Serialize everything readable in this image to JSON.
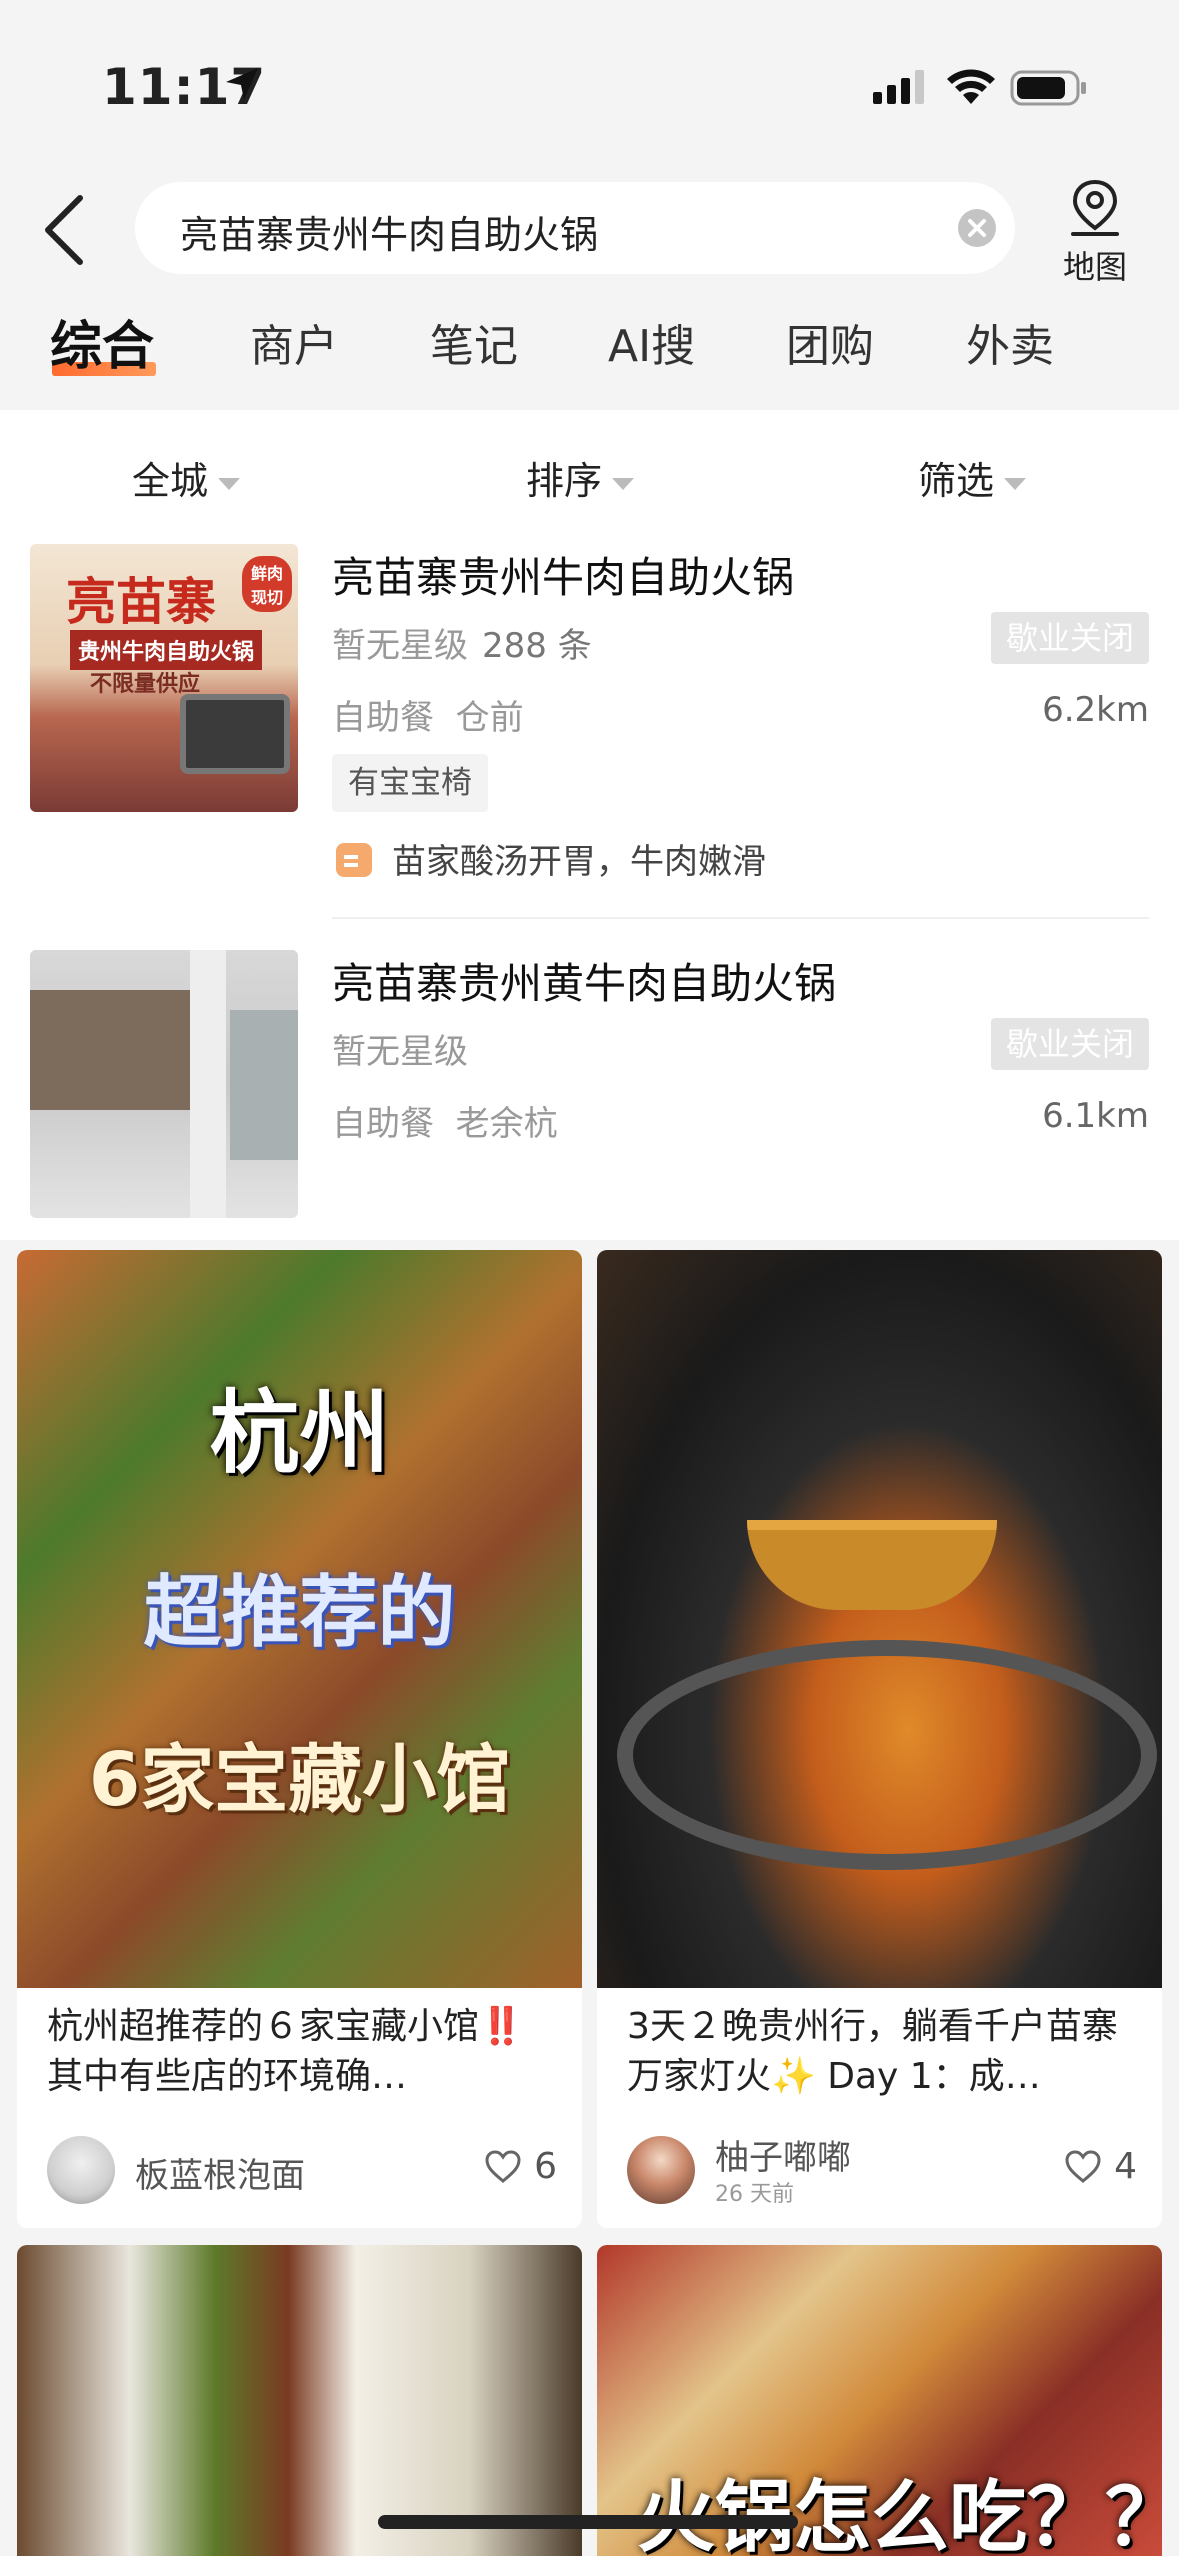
{
  "status_bar": {
    "time": "11:17"
  },
  "header": {
    "search_query": "亮苗寨贵州牛肉自助火锅",
    "map_label": "地图"
  },
  "tabs": [
    {
      "label": "综合",
      "active": true
    },
    {
      "label": "商户"
    },
    {
      "label": "笔记"
    },
    {
      "label": "AI搜"
    },
    {
      "label": "团购"
    },
    {
      "label": "外卖"
    }
  ],
  "filters": [
    {
      "label": "全城"
    },
    {
      "label": "排序"
    },
    {
      "label": "筛选"
    }
  ],
  "shops": [
    {
      "name": "亮苗寨贵州牛肉自助火锅",
      "rating": "暂无星级",
      "reviews": "288 条",
      "status": "歇业关闭",
      "category": "自助餐",
      "area": "仓前",
      "distance": "6.2km",
      "tag": "有宝宝椅",
      "quote": "苗家酸汤开胃，牛肉嫩滑",
      "image_text": {
        "brand": "亮苗寨",
        "sub": "贵州牛肉自助火锅",
        "note": "不限量供应",
        "badge": "鲜肉现切"
      }
    },
    {
      "name": "亮苗寨贵州黄牛肉自助火锅",
      "rating": "暂无星级",
      "status": "歇业关闭",
      "category": "自助餐",
      "area": "老余杭",
      "distance": "6.1km"
    }
  ],
  "notes": [
    {
      "title": "杭州超推荐的６家宝藏小馆‼️其中有些店的环境确…",
      "author": "板蓝根泡面",
      "likes": "6",
      "image_text": [
        "杭州",
        "超推荐的",
        "6家宝藏小馆"
      ]
    },
    {
      "title": "3天２晚贵州行，躺看千户苗寨万家灯火✨ Day 1：成…",
      "author": "柚子嘟嘟",
      "time": "26 天前",
      "likes": "4"
    },
    {
      "image_text": ""
    },
    {
      "image_text": "火锅怎么吃？？"
    }
  ],
  "colors": {
    "accent": "#ff6a2f",
    "closed_badge": "#e4e4e4",
    "page_bg": "#f4f4f4"
  }
}
